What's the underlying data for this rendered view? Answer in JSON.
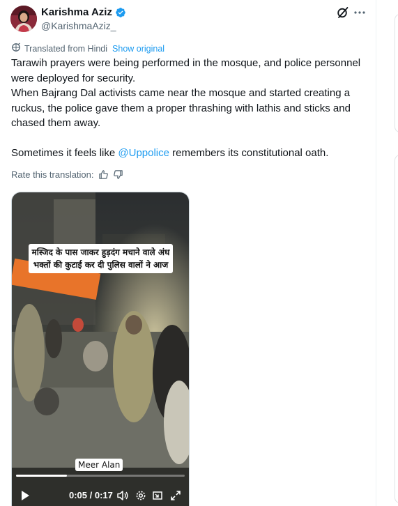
{
  "author": {
    "display_name": "Karishma Aziz",
    "handle": "@KarishmaAziz_",
    "verified": true,
    "verified_color": "#1d9bf0"
  },
  "translation": {
    "label": "Translated from Hindi",
    "show_original": "Show original",
    "rate_label": "Rate this translation:"
  },
  "tweet": {
    "line1": "Tarawih prayers were being performed in the mosque, and police personnel were deployed for security.",
    "line2": "When Bajrang Dal activists came near the mosque and started creating a ruckus, the police gave them a proper thrashing with lathis and sticks and chased them away.",
    "line3_before": "Sometimes it feels like ",
    "line3_mention": "@Uppolice",
    "line3_after": " remembers its constitutional oath."
  },
  "video": {
    "caption": "मस्जिद के पास जाकर हुड़दंग मचाने वाले अंध भक्तों की कुटाई कर दी पुलिस वालों ने आज",
    "watermark": "Meer Alan",
    "current_time": "0:05",
    "duration": "0:17",
    "time_display": "0:05 / 0:17",
    "progress": 0.3
  },
  "icons": {
    "grok": "grok-icon",
    "more": "more-icon",
    "translate": "translate-icon",
    "thumbs_up": "thumbs-up-icon",
    "thumbs_down": "thumbs-down-icon",
    "play": "play-icon",
    "volume": "volume-icon",
    "settings": "settings-icon",
    "pip": "pip-icon",
    "fullscreen": "fullscreen-icon"
  },
  "colors": {
    "link": "#1d9bf0",
    "secondary_text": "#536471",
    "primary_text": "#0f1419"
  }
}
